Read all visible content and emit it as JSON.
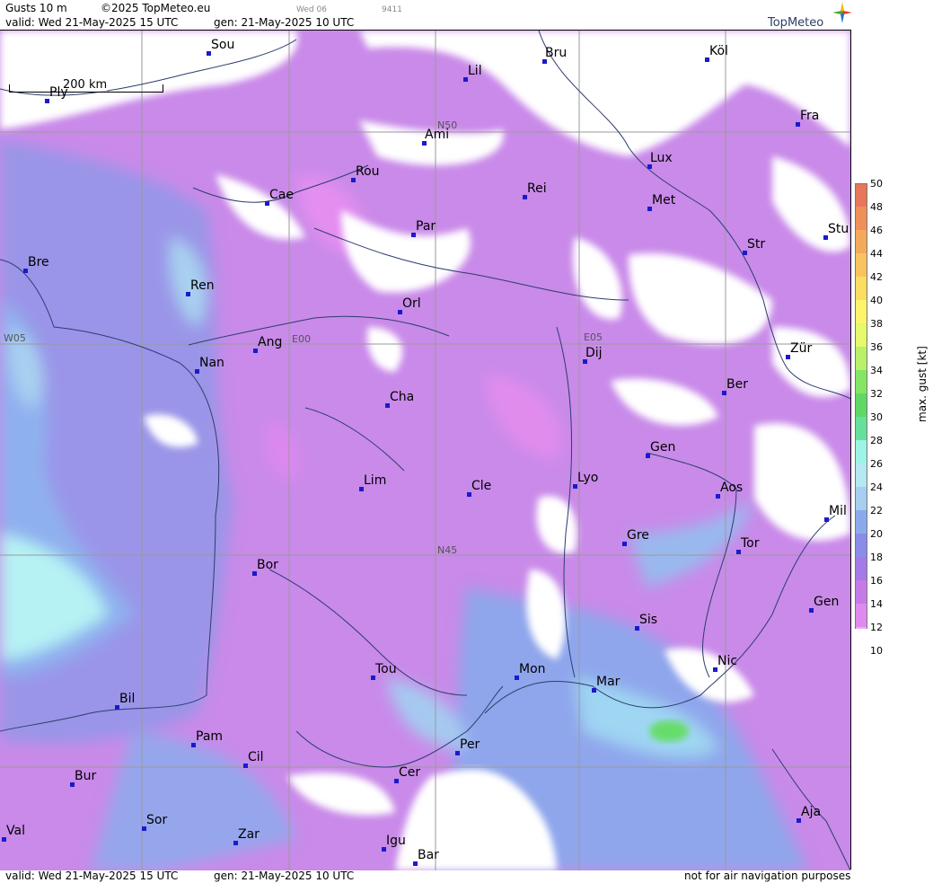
{
  "header": {
    "product": "Gusts 10 m",
    "copyright": "©2025 TopMeteo.eu",
    "valid_top": "valid:  Wed  21-May-2025  15 UTC",
    "gen_top": "gen:  21-May-2025  10 UTC",
    "code1": "Wed 06",
    "code2": "9411",
    "brand": "TopMeteo"
  },
  "footer": {
    "valid": "valid:  Wed  21-May-2025  15 UTC",
    "gen": "gen:  21-May-2025  10 UTC",
    "disclaimer": "not for air navigation purposes"
  },
  "scale": {
    "label": "200 km"
  },
  "grid_labels": [
    "N50",
    "W05",
    "E00",
    "E05",
    "N45"
  ],
  "cities": [
    "Sou",
    "Bru",
    "Köl",
    "Lil",
    "Ply",
    "Ami",
    "Fra",
    "Lux",
    "Rou",
    "Cae",
    "Rei",
    "Met",
    "Par",
    "Stu",
    "Bre",
    "Str",
    "Ren",
    "Orl",
    "W05",
    "Ang",
    "Dij",
    "Zür",
    "Nan",
    "Ber",
    "Cha",
    "Gen",
    "Lim",
    "Cle",
    "Lyo",
    "Aos",
    "Mil",
    "Gre",
    "Tor",
    "Bor",
    "Gen",
    "Sis",
    "Nic",
    "Tou",
    "Mon",
    "Mar",
    "Bil",
    "Pam",
    "Cil",
    "Per",
    "Bur",
    "Cer",
    "Sor",
    "Aja",
    "Val",
    "Zar",
    "Igu",
    "Bar"
  ],
  "legend": {
    "title": "max. gust  [kt]",
    "ticks": [
      "50",
      "48",
      "46",
      "44",
      "42",
      "40",
      "38",
      "36",
      "34",
      "32",
      "30",
      "28",
      "26",
      "24",
      "22",
      "20",
      "18",
      "16",
      "14",
      "12",
      "10"
    ],
    "colors": [
      "#e8765a",
      "#ef8f5a",
      "#f4a95c",
      "#f8c35e",
      "#fbdd62",
      "#fdf46a",
      "#e6f86c",
      "#b8f06a",
      "#84e565",
      "#5fd865",
      "#66e09a",
      "#9ef3e7",
      "#b4e8f2",
      "#a7cdf0",
      "#8aaaec",
      "#8a8ce8",
      "#a57ae6",
      "#c57ae8",
      "#df8aee",
      "#f0a8f5",
      "#ffffff"
    ]
  }
}
